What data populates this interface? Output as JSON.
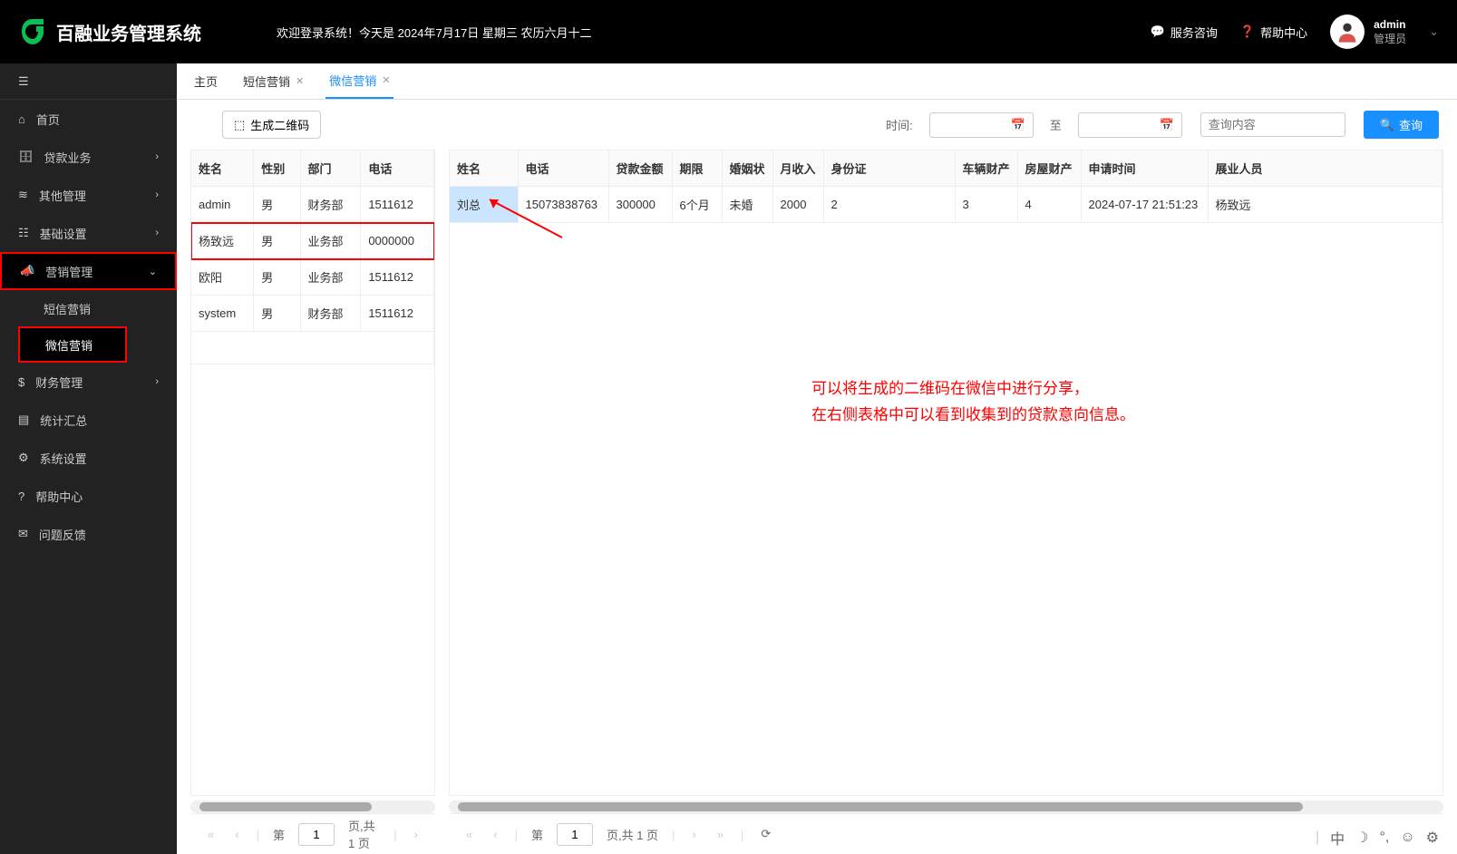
{
  "header": {
    "app_name": "百融业务管理系统",
    "welcome": "欢迎登录系统！今天是 2024年7月17日 星期三 农历六月十二",
    "service_link": "服务咨询",
    "help_link": "帮助中心",
    "user_name": "admin",
    "user_role": "管理员"
  },
  "sidebar": {
    "items": [
      {
        "label": "首页"
      },
      {
        "label": "贷款业务"
      },
      {
        "label": "其他管理"
      },
      {
        "label": "基础设置"
      },
      {
        "label": "营销管理"
      },
      {
        "label": "财务管理"
      },
      {
        "label": "统计汇总"
      },
      {
        "label": "系统设置"
      },
      {
        "label": "帮助中心"
      },
      {
        "label": "问题反馈"
      }
    ],
    "submenu_marketing": [
      {
        "label": "短信营销"
      },
      {
        "label": "微信营销"
      }
    ]
  },
  "tabs": [
    {
      "label": "主页"
    },
    {
      "label": "短信营销"
    },
    {
      "label": "微信营销"
    }
  ],
  "toolbar": {
    "qr_btn": "生成二维码",
    "time_label": "时间:",
    "date_sep": "至",
    "search_placeholder": "查询内容",
    "search_btn": "查询"
  },
  "left_table": {
    "headers": [
      "姓名",
      "性别",
      "部门",
      "电话"
    ],
    "rows": [
      [
        "admin",
        "男",
        "财务部",
        "1511612"
      ],
      [
        "杨致远",
        "男",
        "业务部",
        "0000000"
      ],
      [
        "欧阳",
        "男",
        "业务部",
        "1511612"
      ],
      [
        "system",
        "男",
        "财务部",
        "1511612"
      ]
    ]
  },
  "right_table": {
    "headers": [
      "姓名",
      "电话",
      "贷款金额",
      "期限",
      "婚姻状",
      "月收入",
      "身份证",
      "车辆财产",
      "房屋财产",
      "申请时间",
      "展业人员"
    ],
    "rows": [
      [
        "刘总",
        "15073838763",
        "300000",
        "6个月",
        "未婚",
        "2000",
        "2",
        "3",
        "4",
        "2024-07-17 21:51:23",
        "杨致远"
      ]
    ]
  },
  "annotation": {
    "line1": "可以将生成的二维码在微信中进行分享，",
    "line2": "在右侧表格中可以看到收集到的贷款意向信息。"
  },
  "pagination": {
    "prefix": "第",
    "page_value": "1",
    "total_text": "页,共 1 页"
  },
  "status_bar": {
    "ime": "中"
  }
}
